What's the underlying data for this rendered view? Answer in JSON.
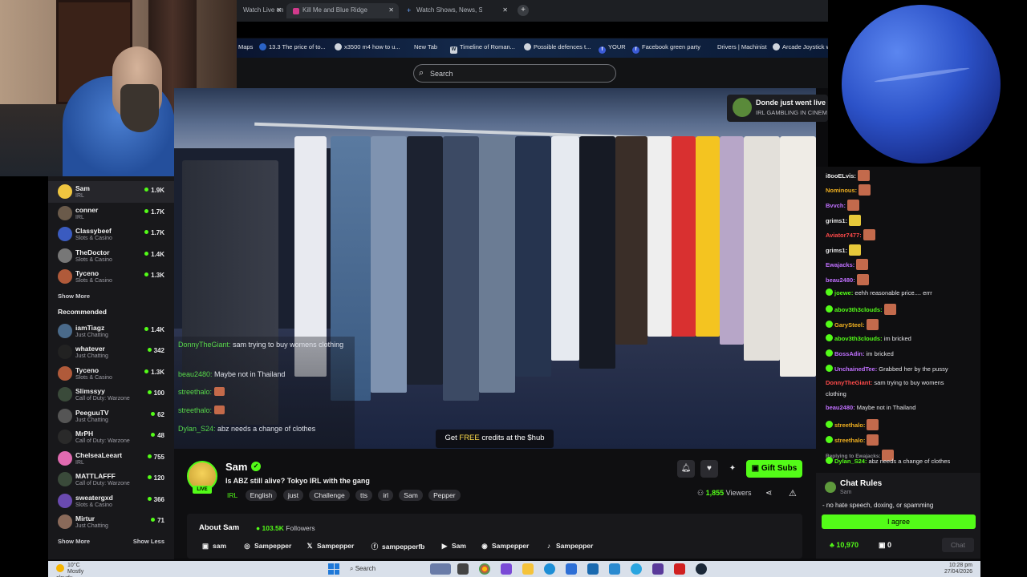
{
  "browser": {
    "tabs": [
      {
        "label": "Watch Live on",
        "color": "#e33"
      },
      {
        "label": "Kill Me and Blue Ridge | Th...",
        "color": "#d23a8c"
      },
      {
        "label": "Watch Shows, News, Sport, Mo",
        "color": "#6aa5ff"
      }
    ],
    "bookmarks": [
      "Maps",
      "13.3 The price of to...",
      "x3500 m4 how to u...",
      "New Tab",
      "Timeline of Roman...",
      "Possible defences t...",
      "YOUR",
      "Facebook green party",
      "Drivers | Machinist",
      "Arcade Joystick w"
    ]
  },
  "site": {
    "search_placeholder": "Search"
  },
  "notification": {
    "title": "Donde just went live",
    "subtitle": "IRL GAMBLING IN CINEM"
  },
  "sidebar": {
    "following": [
      {
        "name": "Sam",
        "category": "IRL",
        "viewers": "1.9K",
        "color": "#f0c640"
      },
      {
        "name": "conner",
        "category": "IRL",
        "viewers": "1.7K",
        "color": "#6a5a4a"
      },
      {
        "name": "Classybeef",
        "category": "Slots & Casino",
        "viewers": "1.7K",
        "color": "#3a5bc0"
      },
      {
        "name": "TheDoctor",
        "category": "Slots & Casino",
        "viewers": "1.4K",
        "color": "#777777"
      },
      {
        "name": "Tyceno",
        "category": "Slots & Casino",
        "viewers": "1.3K",
        "color": "#b05a3a"
      }
    ],
    "show_more": "Show More",
    "recommended_title": "Recommended",
    "recommended": [
      {
        "name": "iamTiagz",
        "category": "Just Chatting",
        "viewers": "1.4K",
        "color": "#4a6a8a"
      },
      {
        "name": "whatever",
        "category": "Just Chatting",
        "viewers": "342",
        "color": "#222222"
      },
      {
        "name": "Tyceno",
        "category": "Slots & Casino",
        "viewers": "1.3K",
        "color": "#b05a3a"
      },
      {
        "name": "Slimssyy",
        "category": "Call of Duty: Warzone",
        "viewers": "100",
        "color": "#3a4a3a"
      },
      {
        "name": "PeeguuTV",
        "category": "Just Chatting",
        "viewers": "62",
        "color": "#555555"
      },
      {
        "name": "MrPH",
        "category": "Call of Duty: Warzone",
        "viewers": "48",
        "color": "#2a2a2a"
      },
      {
        "name": "ChelseaLeeart",
        "category": "IRL",
        "viewers": "755",
        "color": "#e06ab0"
      },
      {
        "name": "MATTLAFFF",
        "category": "Call of Duty: Warzone",
        "viewers": "120",
        "color": "#3a4a3a"
      },
      {
        "name": "sweatergxd",
        "category": "Slots & Casino",
        "viewers": "366",
        "color": "#6a4ab0"
      },
      {
        "name": "Mirtur",
        "category": "Just Chatting",
        "viewers": "71",
        "color": "#8a6a5a"
      }
    ],
    "show_more2": "Show More",
    "show_less": "Show Less"
  },
  "video": {
    "overlay_chat": [
      {
        "user": "DonnyTheGiant:",
        "text": " sam trying to buy womens clothing"
      },
      {
        "user": "beau2480:",
        "text": " Maybe not in Thailand"
      },
      {
        "user": "streethalo:",
        "text": ""
      },
      {
        "user": "streethalo:",
        "text": ""
      },
      {
        "user": "Dylan_S24:",
        "text": " abz needs a change of clothes"
      }
    ],
    "promo_prefix": "Get ",
    "promo_highlight": "FREE",
    "promo_suffix": " credits at the $hub"
  },
  "stream": {
    "streamer": "Sam",
    "live_badge": "LIVE",
    "title": "Is ABZ still alive? Tokyo IRL with the gang",
    "category": "IRL",
    "tags": [
      "English",
      "just",
      "Challenge",
      "tts",
      "irl",
      "Sam",
      "Pepper"
    ],
    "gift_label": "Gift Subs",
    "viewers_count": "1,855",
    "viewers_label": "Viewers",
    "about_title": "About Sam",
    "followers_count": "103.5K",
    "followers_label": "Followers",
    "socials": [
      {
        "icon": "kick-icon",
        "label": "sam"
      },
      {
        "icon": "instagram-icon",
        "label": "Sampepper"
      },
      {
        "icon": "x-icon",
        "label": "Sampepper"
      },
      {
        "icon": "facebook-icon",
        "label": "sampepperfb"
      },
      {
        "icon": "youtube-icon",
        "label": "Sam"
      },
      {
        "icon": "discord-icon",
        "label": "Sampepper"
      },
      {
        "icon": "tiktok-icon",
        "label": "Sampepper"
      }
    ]
  },
  "chat": {
    "messages": [
      {
        "user": "i8ooELvis:",
        "text": "",
        "color": "#e8e8e8",
        "emote": true
      },
      {
        "user": "Nominous:",
        "text": "",
        "color": "#f0b020",
        "emote": true
      },
      {
        "user": "Bvvch:",
        "text": "",
        "color": "#c070ff",
        "emote": true
      },
      {
        "user": "grims1:",
        "text": "",
        "color": "#e8e8e8",
        "emote": true,
        "yellow": true
      },
      {
        "user": "Aviator7477:",
        "text": "",
        "color": "#ff4a4a",
        "emote": true
      },
      {
        "user": "grims1:",
        "text": "",
        "color": "#e8e8e8",
        "emote": true,
        "yellow": true
      },
      {
        "user": "Ewajacks:",
        "text": "",
        "color": "#c070ff",
        "emote": true
      },
      {
        "user": "beau2480:",
        "text": "",
        "color": "#c070ff",
        "emote": true
      },
      {
        "user": "joewe:",
        "text": " eehh reasonable price.... errr",
        "color": "#53fc18",
        "emote": false
      },
      {
        "user": "abov3th3clouds:",
        "text": "",
        "color": "#53fc18",
        "emote": true
      },
      {
        "user": "GarySteel:",
        "text": "",
        "color": "#f0b020",
        "emote": true
      },
      {
        "user": "abov3th3clouds:",
        "text": " im bricked",
        "color": "#53fc18",
        "emote": false
      },
      {
        "user": "BossAdin:",
        "text": " im bricked",
        "color": "#c070ff",
        "emote": false
      },
      {
        "user": "UnchainedTee:",
        "text": " Grabbed her by the pussy",
        "color": "#c070ff",
        "emote": false
      },
      {
        "user": "DonnyTheGiant:",
        "text": " sam trying to buy womens",
        "color": "#ff4a4a",
        "emote": false
      },
      {
        "user": "",
        "text": "clothing",
        "color": "#e8e8e8",
        "emote": false
      },
      {
        "user": "beau2480:",
        "text": " Maybe not in Thailand",
        "color": "#c070ff",
        "emote": false
      },
      {
        "user": "streethalo:",
        "text": "",
        "color": "#f0b020",
        "emote": true
      },
      {
        "user": "streethalo:",
        "text": "",
        "color": "#f0b020",
        "emote": true
      },
      {
        "user": "Replying to Ewajacks:",
        "text": "",
        "color": "#8c8c93",
        "emote": true
      },
      {
        "user": "Dylan_S24:",
        "text": " abz needs a change of clothes",
        "color": "#53fc18",
        "emote": false
      }
    ],
    "rules_title": "Chat Rules",
    "rules_subtitle": "Sam",
    "rule": "- no hate speech, doxing, or spamming",
    "agree": "I agree",
    "points": "10,970",
    "points2": "0",
    "chat_button": "Chat"
  },
  "taskbar": {
    "temp": "10°C",
    "weather": "Mostly cloudy",
    "search": "Search",
    "time": "10:28 pm",
    "date": "27/04/2026"
  }
}
